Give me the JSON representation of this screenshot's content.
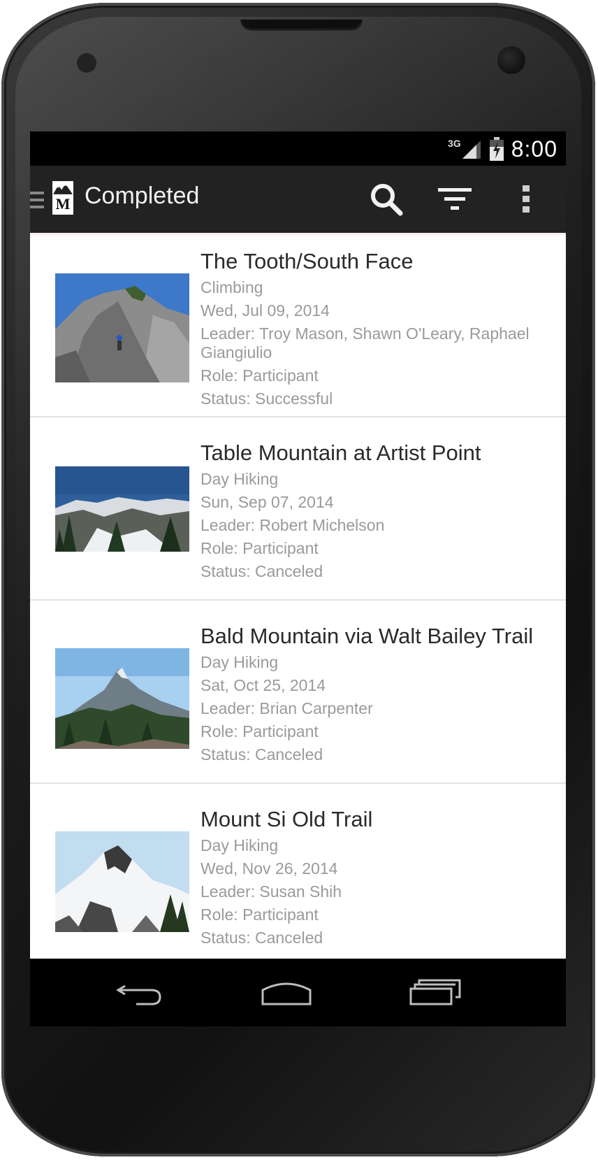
{
  "status_bar": {
    "network": "3G",
    "time": "8:00"
  },
  "action_bar": {
    "title": "Completed",
    "logo_letter": "M",
    "actions": [
      "search-icon",
      "filter-icon",
      "overflow-menu-icon"
    ]
  },
  "trips": [
    {
      "title": "The Tooth/South Face",
      "activity": "Climbing",
      "date": "Wed, Jul 09, 2014",
      "leader": "Leader: Troy Mason, Shawn O'Leary, Raphael Giangiulio",
      "role": "Role: Participant",
      "status": "Status: Successful"
    },
    {
      "title": "Table Mountain at Artist Point",
      "activity": "Day Hiking",
      "date": "Sun, Sep 07, 2014",
      "leader": "Leader: Robert Michelson",
      "role": "Role: Participant",
      "status": "Status: Canceled"
    },
    {
      "title": "Bald Mountain via Walt Bailey Trail",
      "activity": "Day Hiking",
      "date": "Sat, Oct 25, 2014",
      "leader": "Leader: Brian Carpenter",
      "role": "Role: Participant",
      "status": "Status: Canceled"
    },
    {
      "title": "Mount Si Old Trail",
      "activity": "Day Hiking",
      "date": "Wed, Nov 26, 2014",
      "leader": "Leader: Susan Shih",
      "role": "Role: Participant",
      "status": "Status: Canceled"
    }
  ],
  "nav_bar": {
    "buttons": [
      "back-icon",
      "home-icon",
      "recent-apps-icon"
    ]
  },
  "colors": {
    "action_bar": "#222222",
    "title_text": "#2a2a2a",
    "secondary_text": "#9a9a9a",
    "divider": "#e3e3e3"
  }
}
